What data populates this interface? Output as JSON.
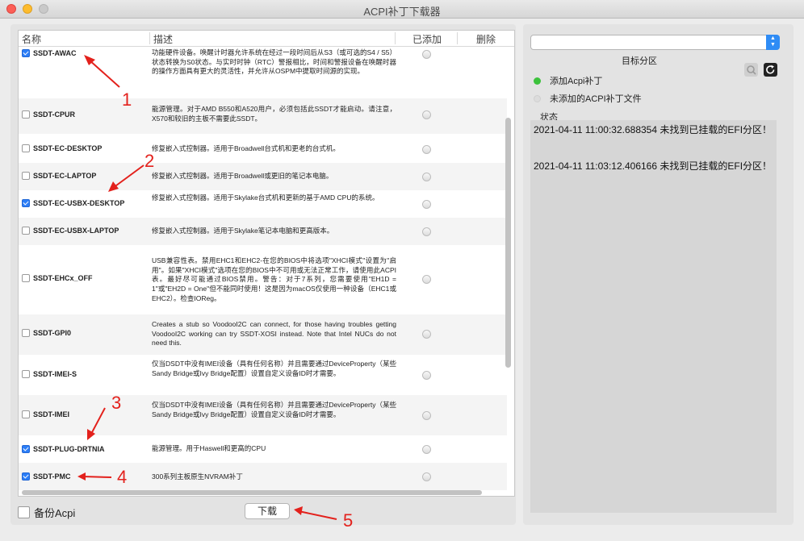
{
  "window": {
    "title": "ACPI补丁下载器"
  },
  "table": {
    "headers": {
      "name": "名称",
      "desc": "描述",
      "added": "已添加",
      "delete": "删除"
    },
    "rows": [
      {
        "name": "SSDT-AWAC",
        "checked": true,
        "desc": "功能硬件设备。唤醒计时器允许系统在经过一段时间后从S3（或可选的S4 / S5）状态转换为S0状态。与实时时钟（RTC）警报相比，时间和警报设备在唤醒时器的操作方面具有更大的灵活性，并允许从OSPM中提取时间源的实现。"
      },
      {
        "name": "SSDT-CPUR",
        "checked": false,
        "desc": "能源管理。对于AMD B550和A520用户，必须包括此SSDT才能启动。请注意，X570和较旧的主板不需要此SSDT。"
      },
      {
        "name": "SSDT-EC-DESKTOP",
        "checked": false,
        "desc": "修复嵌入式控制器。适用于Broadwell台式机和更老的台式机。"
      },
      {
        "name": "SSDT-EC-LAPTOP",
        "checked": false,
        "desc": "修复嵌入式控制器。适用于Broadwell或更旧的笔记本电脑。"
      },
      {
        "name": "SSDT-EC-USBX-DESKTOP",
        "checked": true,
        "desc": "修复嵌入式控制器。适用于Skylake台式机和更新的基于AMD CPU的系统。"
      },
      {
        "name": "SSDT-EC-USBX-LAPTOP",
        "checked": false,
        "desc": "修复嵌入式控制器。适用于Skylake笔记本电脑和更高版本。"
      },
      {
        "name": "SSDT-EHCx_OFF",
        "checked": false,
        "desc": "USB兼容性表。禁用EHC1和EHC2-在您的BIOS中将选项\"XHCI模式\"设置为\"启用\"。如果\"XHCI模式\"选项在您的BIOS中不可用或无法正常工作，请使用此ACPI表。最好尽可能通过BIOS禁用。警告：对于7系列，您需要使用\"EH1D = 1\"或\"EH2D = One\"但不能同时使用！这是因为macOS仅使用一种设备（EHC1或EHC2）。检查IOReg。"
      },
      {
        "name": "SSDT-GPI0",
        "checked": false,
        "desc": "Creates a stub so VoodooI2C can connect, for those having troubles getting VoodooI2C working can try SSDT-XOSI instead. Note that Intel NUCs do not need this."
      },
      {
        "name": "SSDT-IMEI-S",
        "checked": false,
        "desc": "仅当DSDT中没有IMEI设备（具有任何名称）并且需要通过DeviceProperty（某些Sandy Bridge或Ivy Bridge配置）设置自定义设备ID时才需要。"
      },
      {
        "name": "SSDT-IMEI",
        "checked": false,
        "desc": "仅当DSDT中没有IMEI设备（具有任何名称）并且需要通过DeviceProperty（某些Sandy Bridge或Ivy Bridge配置）设置自定义设备ID时才需要。"
      },
      {
        "name": "SSDT-PLUG-DRTNIA",
        "checked": true,
        "desc": "能源管理。用于Haswell和更高的CPU"
      },
      {
        "name": "SSDT-PMC",
        "checked": true,
        "desc": "300系列主板原生NVRAM补丁"
      }
    ]
  },
  "backup": {
    "label": "备份Acpi",
    "checked": false
  },
  "download": {
    "label": "下载"
  },
  "right": {
    "partition_value": "",
    "target_label": "目标分区",
    "options": [
      {
        "label": "添加Acpi补丁",
        "status": "green"
      },
      {
        "label": "未添加的ACPI补丁文件",
        "status": "grey"
      }
    ],
    "status_label": "状态",
    "log": [
      "2021-04-11 11:00:32.688354 未找到已挂载的EFI分区！",
      "2021-04-11 11:03:12.406166 未找到已挂载的EFI分区！"
    ]
  },
  "annotations": [
    "1",
    "2",
    "3",
    "4",
    "5"
  ],
  "colors": {
    "accent": "#2c7ef7",
    "annotation": "#e3211c",
    "status_green": "#3cc23c"
  }
}
